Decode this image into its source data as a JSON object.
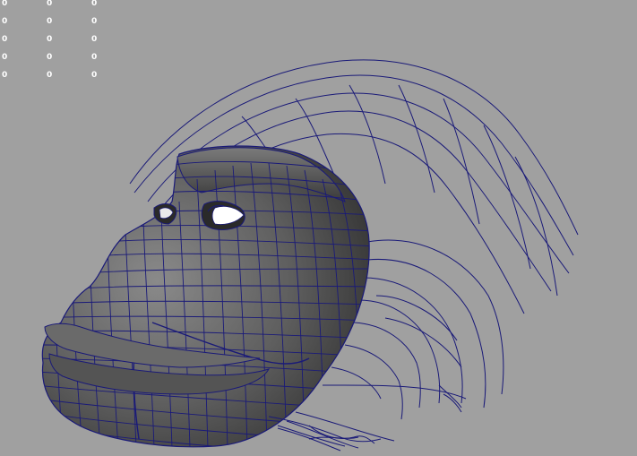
{
  "viewport": {
    "background_color": "#a0a0a0",
    "wire_color": "#1a1a78",
    "mesh_color": "#5c5c5c",
    "hud_text_color": "#ffffff",
    "model": "character-head-wireframe"
  },
  "hud": {
    "rows": [
      [
        "0",
        "0",
        "0"
      ],
      [
        "0",
        "0",
        "0"
      ],
      [
        "0",
        "0",
        "0"
      ],
      [
        "0",
        "0",
        "0"
      ],
      [
        "0",
        "0",
        "0"
      ]
    ]
  }
}
